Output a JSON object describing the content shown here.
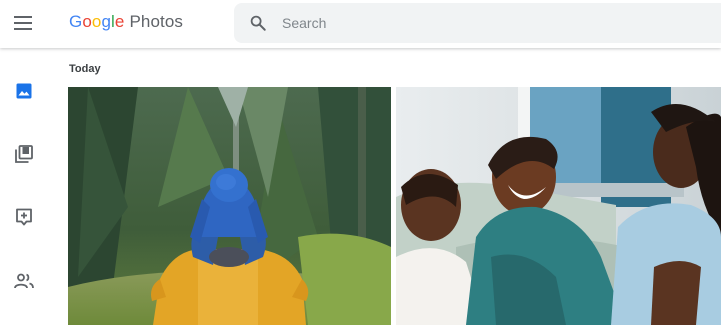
{
  "app": {
    "logo_letters": [
      {
        "char": "G",
        "color": "#4285F4"
      },
      {
        "char": "o",
        "color": "#EA4335"
      },
      {
        "char": "o",
        "color": "#FBBC05"
      },
      {
        "char": "g",
        "color": "#4285F4"
      },
      {
        "char": "l",
        "color": "#34A853"
      },
      {
        "char": "e",
        "color": "#EA4335"
      }
    ],
    "product_name": "Photos"
  },
  "header": {
    "menu_icon": "hamburger-menu-icon",
    "search_icon": "search-icon",
    "search_placeholder": "Search",
    "search_value": ""
  },
  "sidebar": {
    "items": [
      {
        "icon": "photos-icon",
        "active": true,
        "color": "#1a73e8"
      },
      {
        "icon": "albums-icon",
        "active": false,
        "color": "#5f6368"
      },
      {
        "icon": "assistant-icon",
        "active": false,
        "color": "#5f6368"
      },
      {
        "icon": "sharing-icon",
        "active": false,
        "color": "#5f6368"
      }
    ]
  },
  "main": {
    "section_label": "Today",
    "photos": [
      {
        "subject": "child on parent's shoulders in forest"
      },
      {
        "subject": "women laughing on a couch"
      }
    ]
  }
}
